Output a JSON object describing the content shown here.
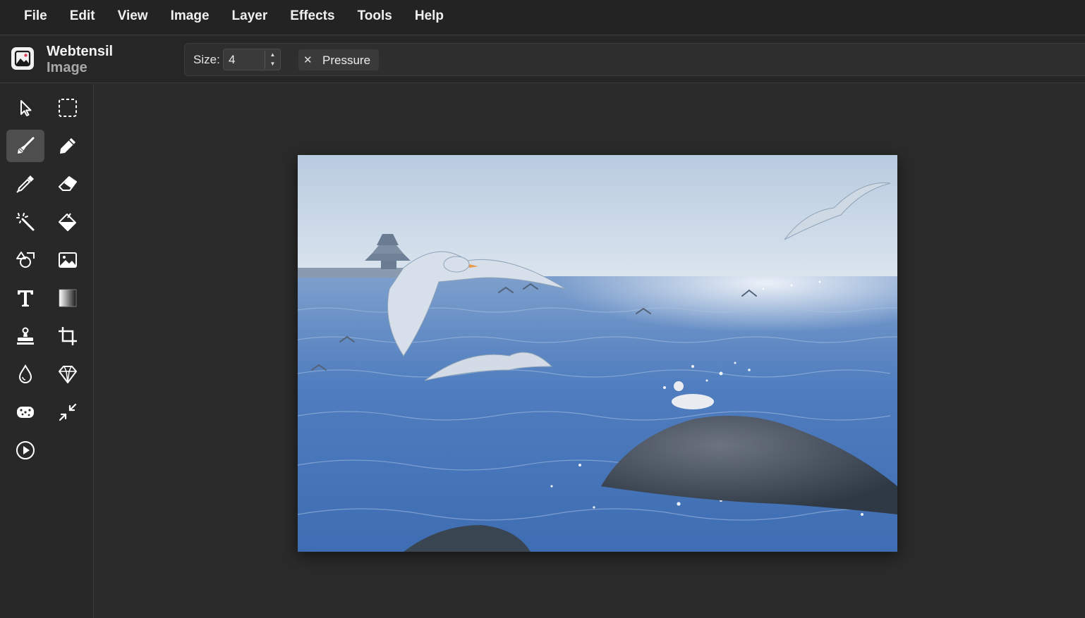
{
  "menu": {
    "items": [
      "File",
      "Edit",
      "View",
      "Image",
      "Layer",
      "Effects",
      "Tools",
      "Help"
    ]
  },
  "app": {
    "name_line1": "Webtensil",
    "name_line2": "Image",
    "logo_icon": "image-icon"
  },
  "tool_options": {
    "size_label": "Size:",
    "size_value": "4",
    "pressure_label": "Pressure",
    "pressure_icon": "close-icon"
  },
  "tools": [
    {
      "name": "select-arrow-icon",
      "active": false
    },
    {
      "name": "marquee-select-icon",
      "active": false
    },
    {
      "name": "paintbrush-icon",
      "active": true
    },
    {
      "name": "pencil-icon",
      "active": false
    },
    {
      "name": "eyedropper-icon",
      "active": false
    },
    {
      "name": "eraser-icon",
      "active": false
    },
    {
      "name": "magic-wand-icon",
      "active": false
    },
    {
      "name": "paint-bucket-icon",
      "active": false
    },
    {
      "name": "shapes-icon",
      "active": false
    },
    {
      "name": "image-insert-icon",
      "active": false
    },
    {
      "name": "text-icon",
      "active": false
    },
    {
      "name": "gradient-icon",
      "active": false
    },
    {
      "name": "clone-stamp-icon",
      "active": false
    },
    {
      "name": "crop-icon",
      "active": false
    },
    {
      "name": "blur-drop-icon",
      "active": false
    },
    {
      "name": "sharpen-gem-icon",
      "active": false
    },
    {
      "name": "sponge-icon",
      "active": false
    },
    {
      "name": "resize-compress-icon",
      "active": false
    },
    {
      "name": "play-icon",
      "active": false
    }
  ],
  "canvas": {
    "image_subject": "seagulls-over-sea-photo"
  },
  "colors": {
    "background": "#2b2b2b",
    "menubar": "#232323",
    "active_tool": "#4e4e4e"
  }
}
